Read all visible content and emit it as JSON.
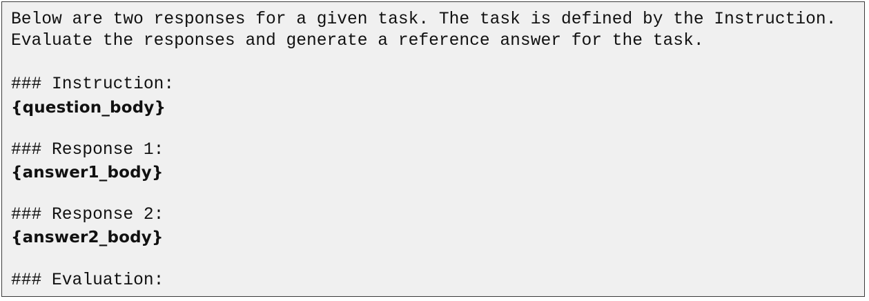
{
  "prompt": {
    "intro_line_1": "Below are two responses for a given task. The task is defined by the Instruction.",
    "intro_line_2": "Evaluate the responses and generate a reference answer for the task.",
    "instruction_header": "### Instruction:",
    "question_placeholder": "{question_body}",
    "response1_header": "### Response 1:",
    "answer1_placeholder": "{answer1_body}",
    "response2_header": "### Response 2:",
    "answer2_placeholder": "{answer2_body}",
    "evaluation_header": "### Evaluation:"
  }
}
